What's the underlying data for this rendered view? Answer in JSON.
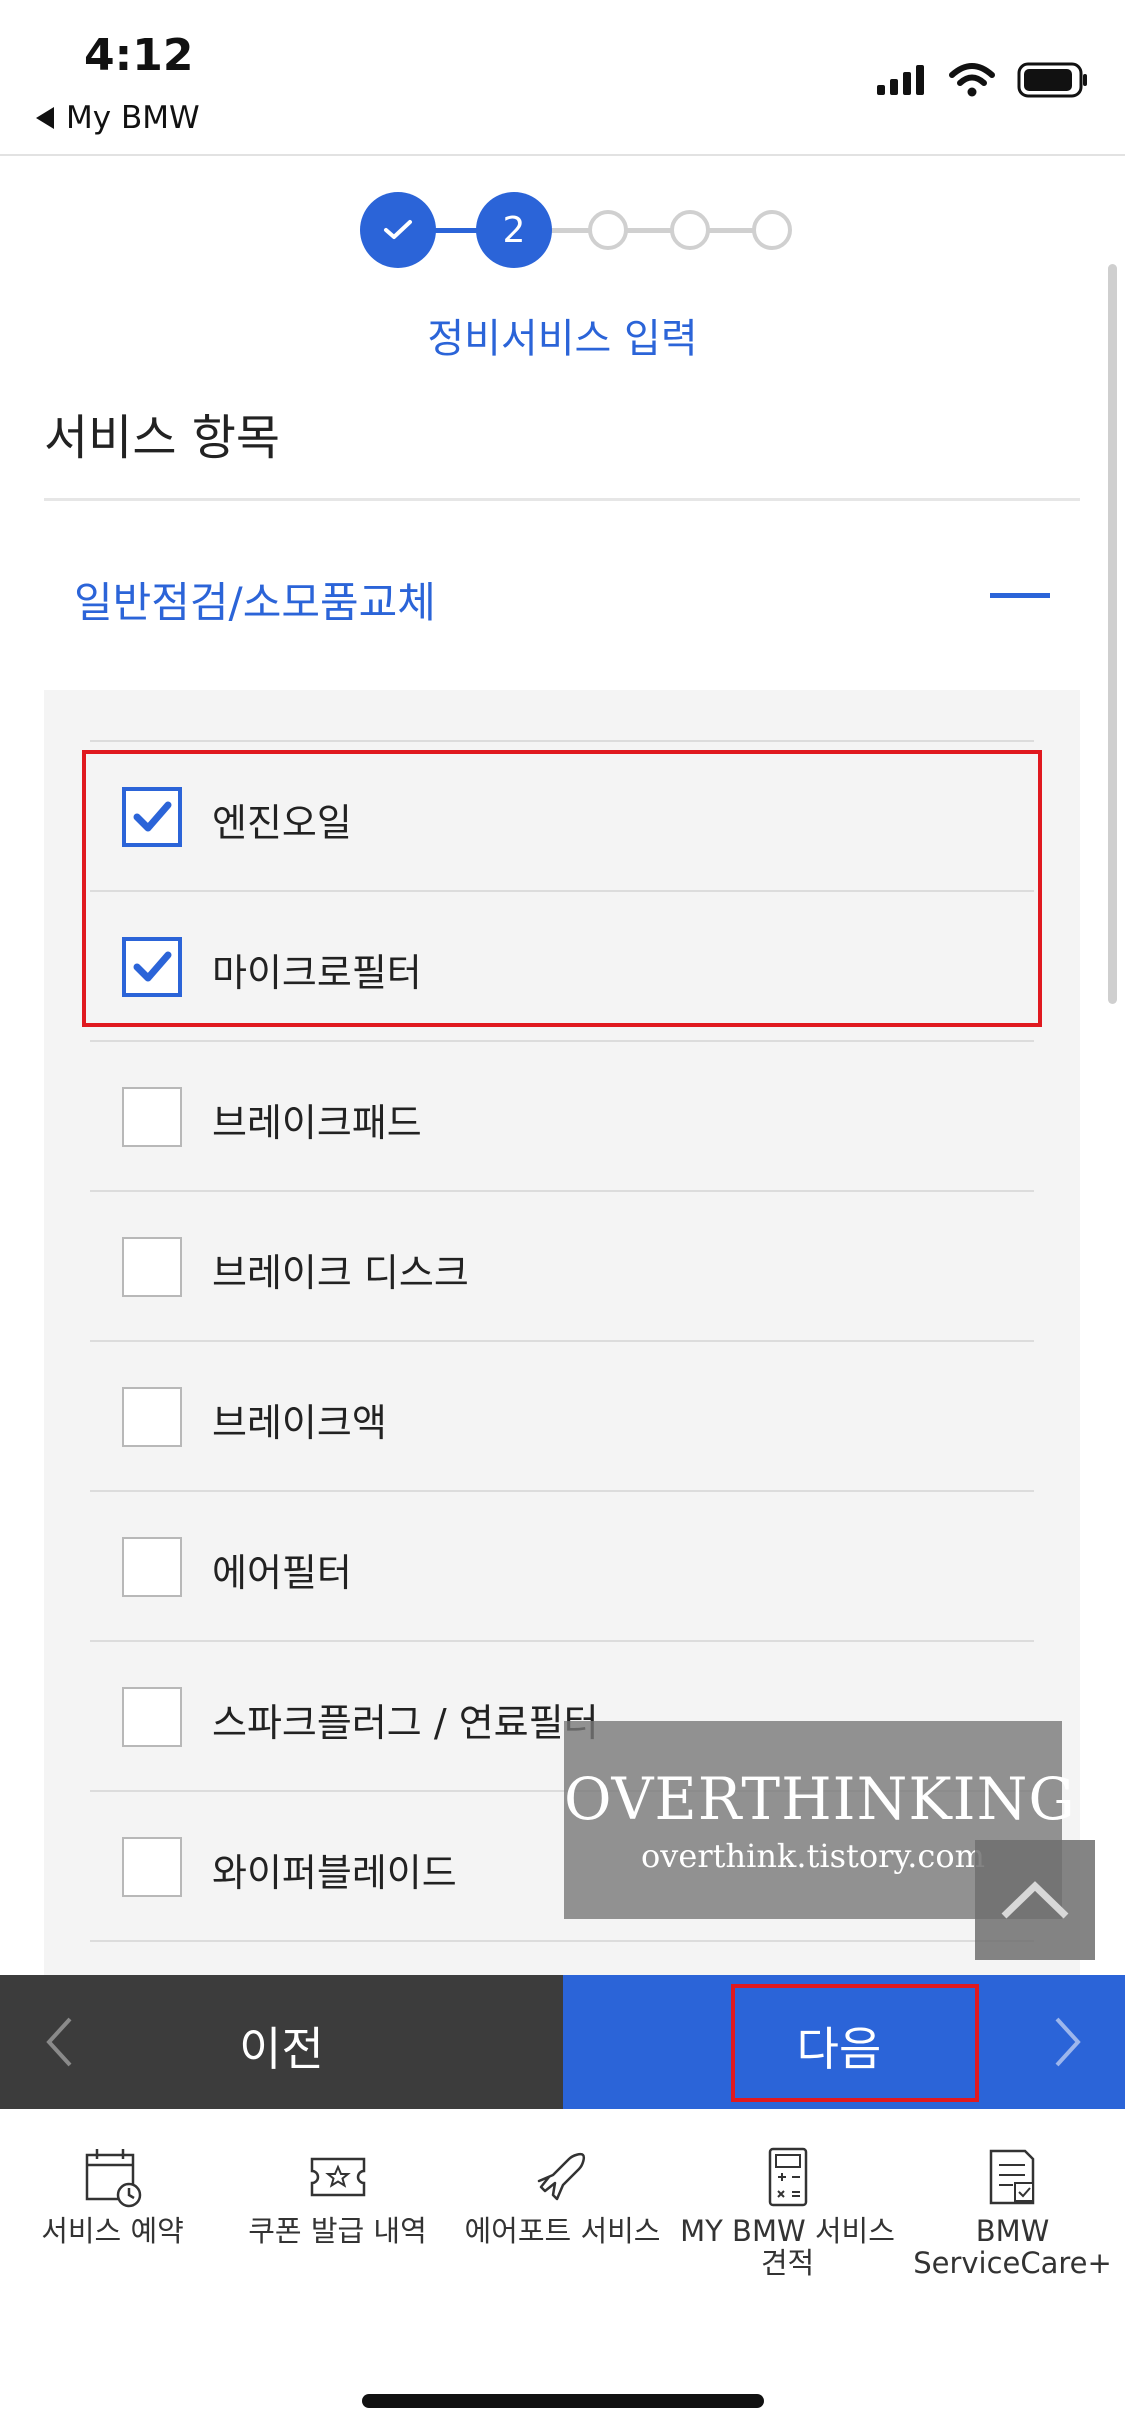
{
  "status_bar": {
    "time": "4:12",
    "back_app": "My BMW",
    "icons": [
      "signal-icon",
      "wifi-icon",
      "battery-icon"
    ]
  },
  "stepper": {
    "current_step": "2",
    "title": "정비서비스 입력"
  },
  "section": {
    "title": "서비스 항목",
    "category": "일반점검/소모품교체"
  },
  "items": [
    {
      "label": "엔진오일",
      "checked": true
    },
    {
      "label": "마이크로필터",
      "checked": true
    },
    {
      "label": "브레이크패드",
      "checked": false
    },
    {
      "label": "브레이크 디스크",
      "checked": false
    },
    {
      "label": "브레이크액",
      "checked": false
    },
    {
      "label": "에어필터",
      "checked": false
    },
    {
      "label": "스파크플러그 / 연료필터",
      "checked": false
    },
    {
      "label": "와이퍼블레이드",
      "checked": false
    }
  ],
  "watermark": {
    "title": "OVERTHINKING",
    "url": "overthink.tistory.com"
  },
  "actions": {
    "prev": "이전",
    "next": "다음"
  },
  "tabs": [
    {
      "line1": "서비스 예약",
      "line2": "",
      "icon": "calendar-clock-icon"
    },
    {
      "line1": "쿠폰 발급 내역",
      "line2": "",
      "icon": "coupon-icon"
    },
    {
      "line1": "에어포트 서비스",
      "line2": "",
      "icon": "airplane-icon"
    },
    {
      "line1": "MY BMW 서비스",
      "line2": "견적",
      "icon": "calculator-icon"
    },
    {
      "line1": "BMW",
      "line2": "ServiceCare+",
      "icon": "document-check-icon"
    }
  ],
  "colors": {
    "accent": "#2b64d8",
    "highlight": "#e0191f",
    "prev_button": "#3c3c3c"
  }
}
